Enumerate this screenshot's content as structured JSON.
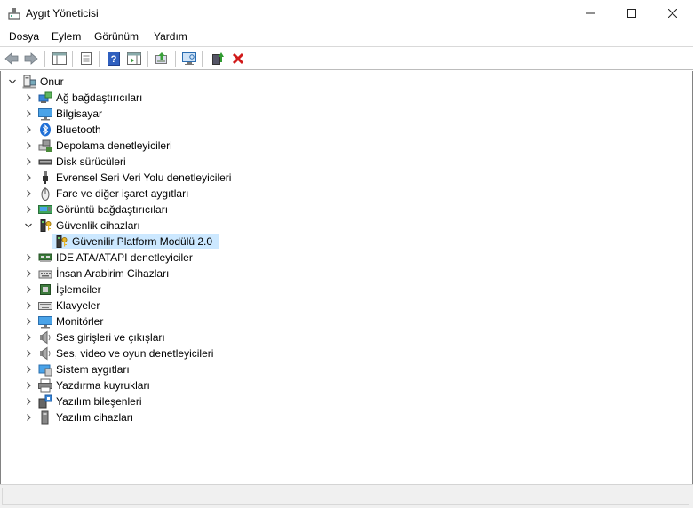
{
  "window": {
    "title": "Aygıt Yöneticisi",
    "minimize_glyph": "—",
    "maximize_glyph": "☐",
    "close_glyph": "✕"
  },
  "menu": [
    "Dosya",
    "Eylem",
    "Görünüm",
    "Yardım"
  ],
  "toolbar": {
    "buttons": [
      "back-arrow-icon",
      "forward-arrow-icon",
      "show-hide-console-tree-icon",
      "properties-icon",
      "help-icon",
      "action-pane-icon",
      "update-driver-icon",
      "scan-hardware-icon",
      "enable-device-icon",
      "uninstall-device-icon"
    ]
  },
  "tree": {
    "root": {
      "label": "Onur",
      "icon": "computer-icon",
      "expanded": true
    },
    "categories": [
      {
        "label": "Ağ bağdaştırıcıları",
        "icon": "network-adapter-icon",
        "expanded": false
      },
      {
        "label": "Bilgisayar",
        "icon": "monitor-icon",
        "expanded": false
      },
      {
        "label": "Bluetooth",
        "icon": "bluetooth-icon",
        "expanded": false
      },
      {
        "label": "Depolama denetleyicileri",
        "icon": "storage-controller-icon",
        "expanded": false
      },
      {
        "label": "Disk sürücüleri",
        "icon": "disk-drive-icon",
        "expanded": false
      },
      {
        "label": "Evrensel Seri Veri Yolu denetleyicileri",
        "icon": "usb-icon",
        "expanded": false
      },
      {
        "label": "Fare ve diğer işaret aygıtları",
        "icon": "mouse-icon",
        "expanded": false
      },
      {
        "label": "Görüntü bağdaştırıcıları",
        "icon": "display-adapter-icon",
        "expanded": false
      },
      {
        "label": "Güvenlik cihazları",
        "icon": "security-device-icon",
        "expanded": true,
        "children": [
          {
            "label": "Güvenilir Platform Modülü 2.0",
            "icon": "security-device-icon",
            "selected": true
          }
        ]
      },
      {
        "label": "IDE ATA/ATAPI denetleyiciler",
        "icon": "ide-controller-icon",
        "expanded": false
      },
      {
        "label": "İnsan Arabirim Cihazları",
        "icon": "hid-icon",
        "expanded": false
      },
      {
        "label": "İşlemciler",
        "icon": "processor-icon",
        "expanded": false
      },
      {
        "label": "Klavyeler",
        "icon": "keyboard-icon",
        "expanded": false
      },
      {
        "label": "Monitörler",
        "icon": "monitor-icon",
        "expanded": false
      },
      {
        "label": "Ses girişleri ve çıkışları",
        "icon": "speaker-icon",
        "expanded": false
      },
      {
        "label": "Ses, video ve oyun denetleyicileri",
        "icon": "speaker-icon",
        "expanded": false
      },
      {
        "label": "Sistem aygıtları",
        "icon": "system-device-icon",
        "expanded": false
      },
      {
        "label": "Yazdırma kuyrukları",
        "icon": "printer-icon",
        "expanded": false
      },
      {
        "label": "Yazılım bileşenleri",
        "icon": "software-component-icon",
        "expanded": false
      },
      {
        "label": "Yazılım cihazları",
        "icon": "software-device-icon",
        "expanded": false
      }
    ]
  },
  "colors": {
    "selection": "#cce8ff",
    "accent_blue": "#1e6fd9",
    "uninstall_red": "#d11a1a"
  }
}
